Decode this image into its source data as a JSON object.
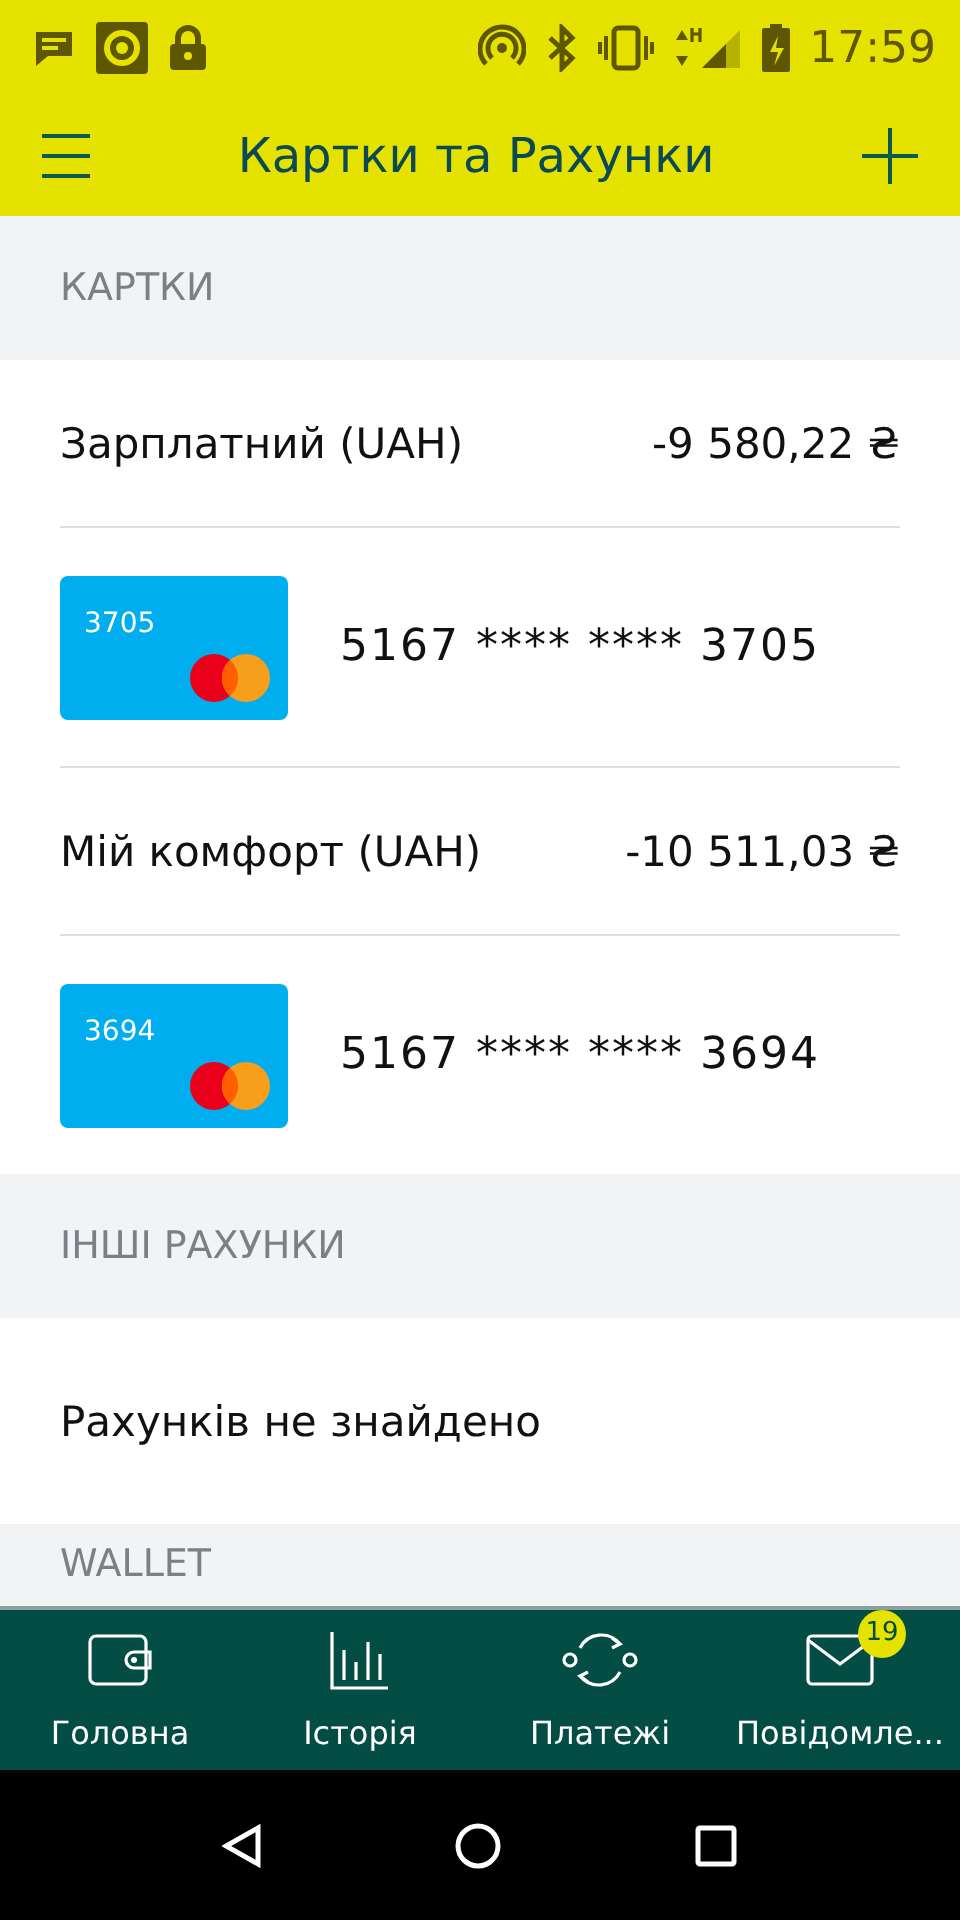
{
  "status_bar": {
    "time": "17:59"
  },
  "app_bar": {
    "title": "Картки та Рахунки"
  },
  "sections": [
    {
      "title": "КАРТКИ",
      "items": [
        {
          "kind": "account",
          "name": "Зарплатний (UAH)",
          "balance": "-9 580,22 ₴"
        },
        {
          "kind": "card",
          "thumb_number": "3705",
          "number": "5167 **** **** 3705"
        },
        {
          "kind": "account",
          "name": "Мій комфорт (UAH)",
          "balance": "-10 511,03 ₴"
        },
        {
          "kind": "card",
          "thumb_number": "3694",
          "number": "5167 **** **** 3694"
        }
      ]
    },
    {
      "title": "ІНШІ РАХУНКИ",
      "items": [
        {
          "kind": "empty",
          "text": "Рахунків не знайдено"
        }
      ]
    },
    {
      "title": "WALLET"
    }
  ],
  "bottom_nav": [
    {
      "kind": "wallet",
      "label": "Головна"
    },
    {
      "kind": "chart",
      "label": "Історія"
    },
    {
      "kind": "exchange",
      "label": "Платежі"
    },
    {
      "kind": "mail",
      "label": "Повідомле...",
      "badge": "19"
    }
  ]
}
